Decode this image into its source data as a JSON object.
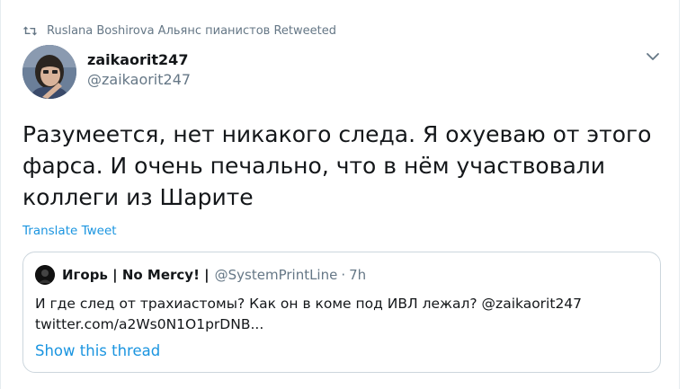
{
  "retweet": {
    "icon": "retweet-icon",
    "text": "Ruslana Boshirova Альянс пианистов Retweeted"
  },
  "author": {
    "display_name": "zaikaorit247",
    "handle": "@zaikaorit247",
    "avatar_icon": "avatar"
  },
  "tweet": {
    "text": "Разумеется, нет никакого следа. Я охуеваю от этого\nфарса. И очень печально, что в нём участвовали\nколлеги из Шарите",
    "translate_label": "Translate Tweet"
  },
  "quote": {
    "name": "Игорь | No Mercy! |",
    "handle": "@SystemPrintLine",
    "dot": "·",
    "time": "7h",
    "body_line1": "И где след от трахиастомы? Как он в коме под ИВЛ лежал? @zaikaorit247",
    "body_line2": "twitter.com/a2Ws0N1O1prDNB...",
    "show_thread": "Show this thread"
  },
  "colors": {
    "link": "#1b95e0",
    "secondary": "#657786",
    "text": "#14171a",
    "border": "#ccd6dd"
  }
}
